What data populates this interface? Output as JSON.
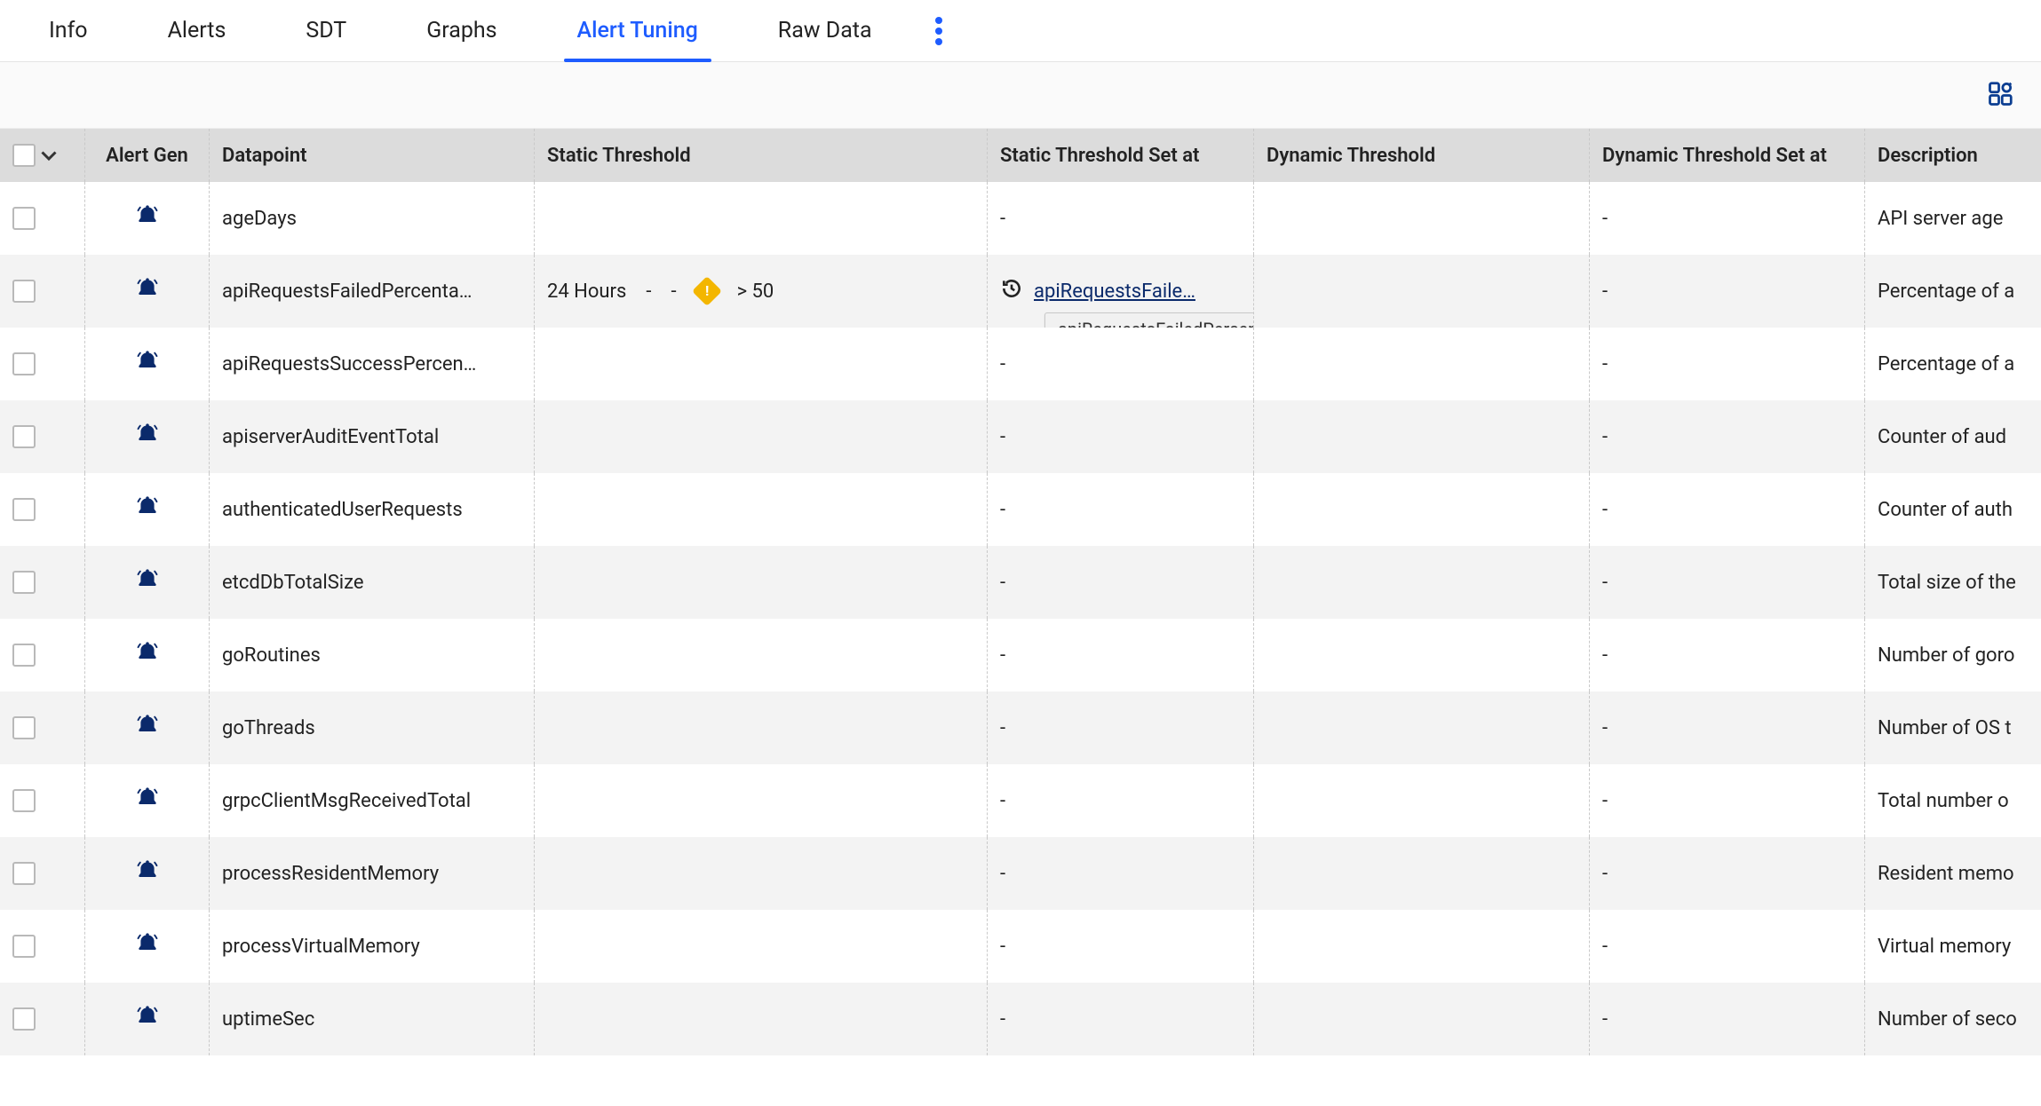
{
  "tabs": [
    {
      "label": "Info"
    },
    {
      "label": "Alerts"
    },
    {
      "label": "SDT"
    },
    {
      "label": "Graphs"
    },
    {
      "label": "Alert Tuning",
      "active": true
    },
    {
      "label": "Raw Data"
    }
  ],
  "columns": {
    "alert_gen": "Alert Gen",
    "datapoint": "Datapoint",
    "static_threshold": "Static Threshold",
    "static_set_at": "Static Threshold Set at",
    "dynamic_threshold": "Dynamic Threshold",
    "dynamic_set_at": "Dynamic Threshold Set at",
    "description": "Description"
  },
  "static_thresh_row": {
    "duration": "24 Hours",
    "operator": "> 50"
  },
  "setat_link": {
    "text": "apiRequestsFaile…",
    "tooltip": "apiRequestsFailedPercentage"
  },
  "rows": [
    {
      "datapoint": "ageDays",
      "static": "",
      "setat": "-",
      "dyn": "",
      "dynset": "-",
      "desc": "API server age"
    },
    {
      "datapoint": "apiRequestsFailedPercenta…",
      "static": "CUSTOM",
      "setat": "LINK",
      "dyn": "",
      "dynset": "-",
      "desc": "Percentage of a"
    },
    {
      "datapoint": "apiRequestsSuccessPercen…",
      "static": "",
      "setat": "-",
      "dyn": "",
      "dynset": "-",
      "desc": "Percentage of a"
    },
    {
      "datapoint": "apiserverAuditEventTotal",
      "static": "",
      "setat": "-",
      "dyn": "",
      "dynset": "-",
      "desc": "Counter of aud"
    },
    {
      "datapoint": "authenticatedUserRequests",
      "static": "",
      "setat": "-",
      "dyn": "",
      "dynset": "-",
      "desc": "Counter of auth"
    },
    {
      "datapoint": "etcdDbTotalSize",
      "static": "",
      "setat": "-",
      "dyn": "",
      "dynset": "-",
      "desc": "Total size of the"
    },
    {
      "datapoint": "goRoutines",
      "static": "",
      "setat": "-",
      "dyn": "",
      "dynset": "-",
      "desc": "Number of goro"
    },
    {
      "datapoint": "goThreads",
      "static": "",
      "setat": "-",
      "dyn": "",
      "dynset": "-",
      "desc": "Number of OS t"
    },
    {
      "datapoint": "grpcClientMsgReceivedTotal",
      "static": "",
      "setat": "-",
      "dyn": "",
      "dynset": "-",
      "desc": "Total number o"
    },
    {
      "datapoint": "processResidentMemory",
      "static": "",
      "setat": "-",
      "dyn": "",
      "dynset": "-",
      "desc": "Resident memo"
    },
    {
      "datapoint": "processVirtualMemory",
      "static": "",
      "setat": "-",
      "dyn": "",
      "dynset": "-",
      "desc": "Virtual memory"
    },
    {
      "datapoint": "uptimeSec",
      "static": "",
      "setat": "-",
      "dyn": "",
      "dynset": "-",
      "desc": "Number of seco"
    }
  ]
}
